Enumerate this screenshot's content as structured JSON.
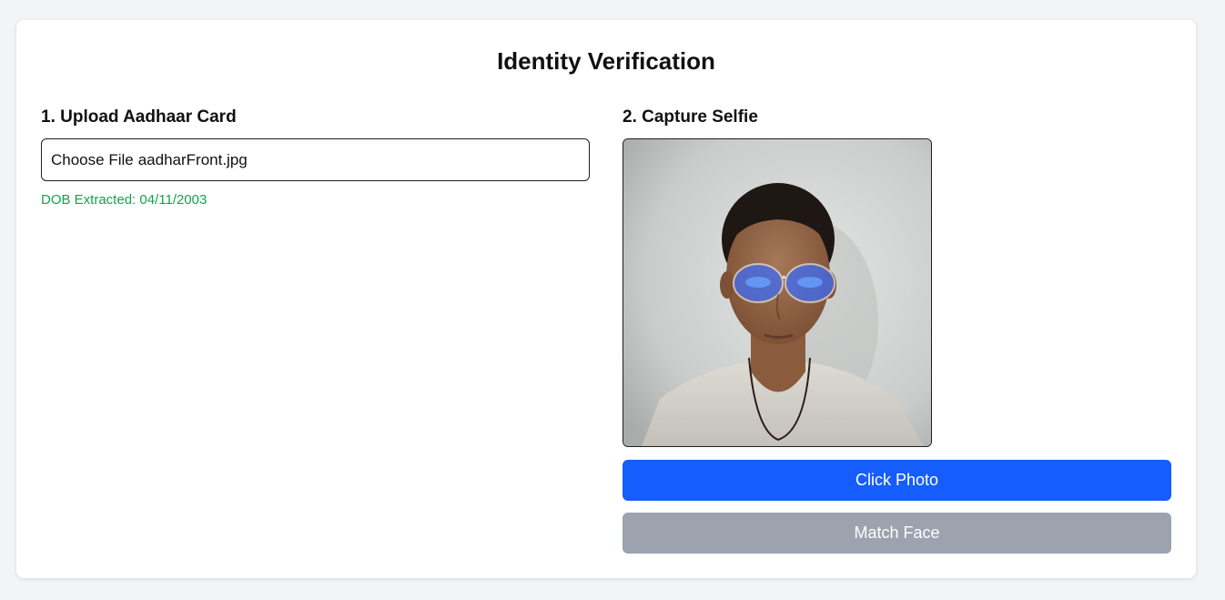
{
  "page": {
    "title": "Identity Verification"
  },
  "upload_section": {
    "heading": "1. Upload Aadhaar Card",
    "file_button_label": "Choose File",
    "file_name": "aadharFront.jpg",
    "dob_status": "DOB Extracted: 04/11/2003"
  },
  "selfie_section": {
    "heading": "2. Capture Selfie",
    "click_photo_label": "Click Photo",
    "match_face_label": "Match Face"
  },
  "colors": {
    "primary_button": "#155dfc",
    "disabled_button": "#9ca3af",
    "success_text": "#16a34a",
    "page_background": "#f3f4f6"
  }
}
